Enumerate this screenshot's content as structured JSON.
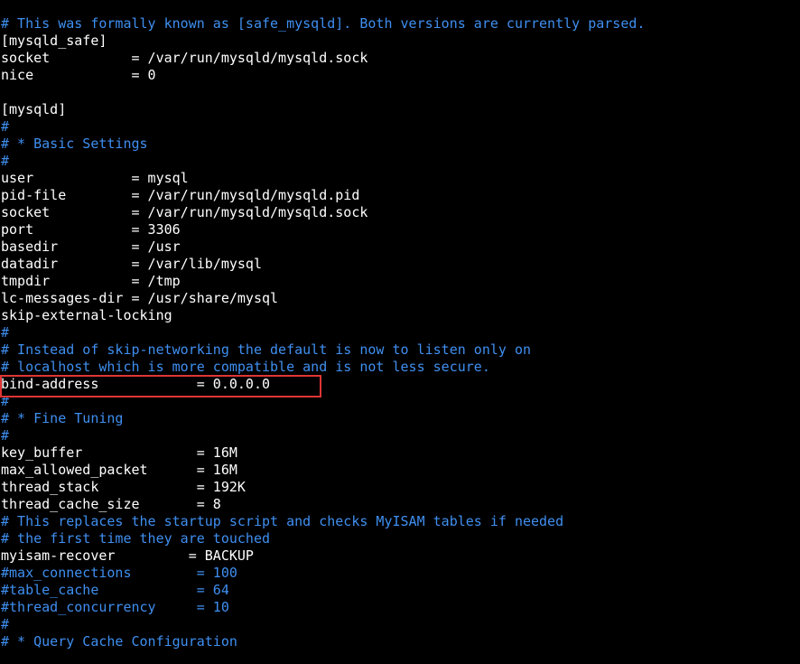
{
  "terminal": {
    "lines": [
      {
        "type": "comment",
        "text": "# This was formally known as [safe_mysqld]. Both versions are currently parsed."
      },
      {
        "type": "setting",
        "text": "[mysqld_safe]"
      },
      {
        "type": "setting",
        "text": "socket          = /var/run/mysqld/mysqld.sock"
      },
      {
        "type": "setting",
        "text": "nice            = 0"
      },
      {
        "type": "blank",
        "text": ""
      },
      {
        "type": "setting",
        "text": "[mysqld]"
      },
      {
        "type": "comment",
        "text": "#"
      },
      {
        "type": "comment",
        "text": "# * Basic Settings"
      },
      {
        "type": "comment",
        "text": "#"
      },
      {
        "type": "setting",
        "text": "user            = mysql"
      },
      {
        "type": "setting",
        "text": "pid-file        = /var/run/mysqld/mysqld.pid"
      },
      {
        "type": "setting",
        "text": "socket          = /var/run/mysqld/mysqld.sock"
      },
      {
        "type": "setting",
        "text": "port            = 3306"
      },
      {
        "type": "setting",
        "text": "basedir         = /usr"
      },
      {
        "type": "setting",
        "text": "datadir         = /var/lib/mysql"
      },
      {
        "type": "setting",
        "text": "tmpdir          = /tmp"
      },
      {
        "type": "setting",
        "text": "lc-messages-dir = /usr/share/mysql"
      },
      {
        "type": "setting",
        "text": "skip-external-locking"
      },
      {
        "type": "comment",
        "text": "#"
      },
      {
        "type": "comment",
        "text": "# Instead of skip-networking the default is now to listen only on"
      },
      {
        "type": "comment",
        "text": "# localhost which is more compatible and is not less secure."
      },
      {
        "type": "setting",
        "text": "bind-address            = 0.0.0.0"
      },
      {
        "type": "comment",
        "text": "#"
      },
      {
        "type": "comment",
        "text": "# * Fine Tuning"
      },
      {
        "type": "comment",
        "text": "#"
      },
      {
        "type": "setting",
        "text": "key_buffer              = 16M"
      },
      {
        "type": "setting",
        "text": "max_allowed_packet      = 16M"
      },
      {
        "type": "setting",
        "text": "thread_stack            = 192K"
      },
      {
        "type": "setting",
        "text": "thread_cache_size       = 8"
      },
      {
        "type": "comment",
        "text": "# This replaces the startup script and checks MyISAM tables if needed"
      },
      {
        "type": "comment",
        "text": "# the first time they are touched"
      },
      {
        "type": "setting",
        "text": "myisam-recover         = BACKUP"
      },
      {
        "type": "comment",
        "text": "#max_connections        = 100"
      },
      {
        "type": "comment",
        "text": "#table_cache            = 64"
      },
      {
        "type": "comment",
        "text": "#thread_concurrency     = 10"
      },
      {
        "type": "comment",
        "text": "#"
      },
      {
        "type": "comment",
        "text": "# * Query Cache Configuration"
      }
    ]
  },
  "colors": {
    "background": "#000000",
    "setting_text": "#ffffff",
    "comment_text": "#3f8ff0",
    "highlight_border": "#e03535"
  }
}
